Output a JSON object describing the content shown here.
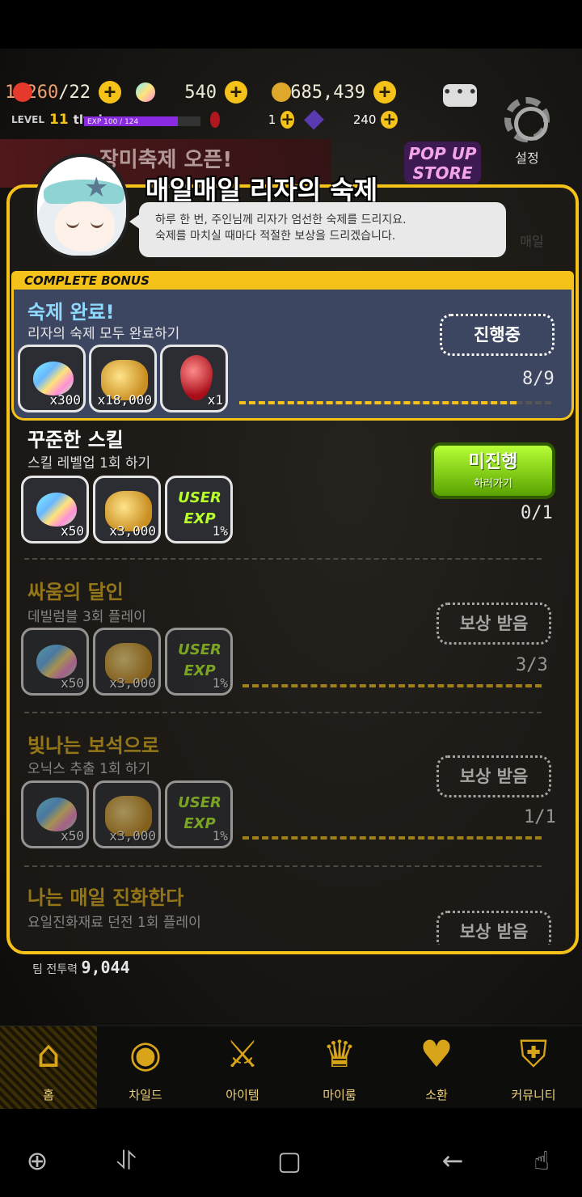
{
  "hud": {
    "hearts": "1,260",
    "hearts_max": "/22",
    "gems": "540",
    "gold": "685,439",
    "level_label": "LEVEL",
    "level": "11",
    "username": "tlysj",
    "exp_text": "EXP 100 / 124",
    "exp_progress": 0.806,
    "ruby_count": "1",
    "crystal_count": "240",
    "settings_label": "설정"
  },
  "background": {
    "banner_text": "장미축제 오픈!",
    "popup_store": "POP UP STORE",
    "side_items": [
      "매일"
    ]
  },
  "panel": {
    "title": "매일매일 리자의 숙제",
    "speech_line1": "하루 한 번, 주인님께 리자가 엄선한 숙제를 드리지요.",
    "speech_line2": "숙제를 마치실 때마다 적절한 보상을 드리겠습니다.",
    "bonus_tag": "COMPLETE BONUS",
    "bonus": {
      "title": "숙제 완료!",
      "desc": "리자의 숙제 모두 완료하기",
      "button": "진행중",
      "progress": "8/9",
      "progress_fraction": 0.889,
      "rewards": [
        {
          "type": "gem",
          "qty": "x300"
        },
        {
          "type": "gold",
          "qty": "x18,000"
        },
        {
          "type": "ruby",
          "qty": "x1"
        }
      ]
    },
    "quests": [
      {
        "title": "꾸준한 스킬",
        "desc": "스킬 레벨업 1회 하기",
        "button": "미진행",
        "button_sub": "하러가기",
        "progress": "0/1",
        "progress_fraction": 0,
        "rewards": [
          {
            "type": "gem",
            "qty": "x50"
          },
          {
            "type": "gold",
            "qty": "x3,000"
          },
          {
            "type": "exp",
            "label": "USER EXP",
            "qty": "1%"
          }
        ]
      },
      {
        "title": "싸움의 달인",
        "desc": "데빌럼블 3회 플레이",
        "button": "보상 받음",
        "progress": "3/3",
        "progress_fraction": 1,
        "rewards": [
          {
            "type": "gem",
            "qty": "x50"
          },
          {
            "type": "gold",
            "qty": "x3,000"
          },
          {
            "type": "exp",
            "label": "USER EXP",
            "qty": "1%"
          }
        ]
      },
      {
        "title": "빛나는 보석으로",
        "desc": "오닉스 추출 1회 하기",
        "button": "보상 받음",
        "progress": "1/1",
        "progress_fraction": 1,
        "rewards": [
          {
            "type": "gem",
            "qty": "x50"
          },
          {
            "type": "gold",
            "qty": "x3,000"
          },
          {
            "type": "exp",
            "label": "USER EXP",
            "qty": "1%"
          }
        ]
      },
      {
        "title": "나는 매일 진화한다",
        "desc": "요일진화재료 던전 1회 플레이",
        "button": "보상 받음"
      }
    ]
  },
  "team_power_label": "팀 전투력",
  "team_power": "9,044",
  "nav": [
    "홈",
    "차일드",
    "아이템",
    "마이룸",
    "소환",
    "커뮤니티"
  ],
  "colors": {
    "accent": "#f5c21a",
    "bonus_bg": "#3c4661",
    "green_button": "#5aa300"
  }
}
